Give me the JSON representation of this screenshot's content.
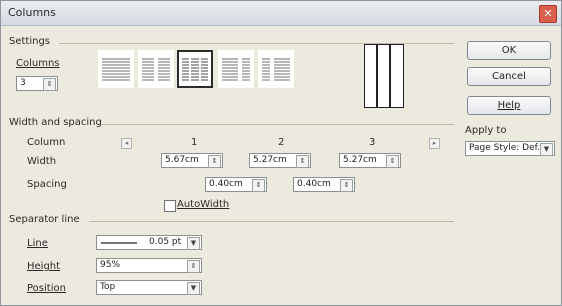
{
  "window": {
    "title": "Columns",
    "close_glyph": "✕"
  },
  "settings": {
    "group_label": "Settings",
    "columns_label": "Columns",
    "columns_value": "3",
    "presets": [
      {
        "name": "one-column-layout",
        "selected": false
      },
      {
        "name": "two-column-layout",
        "selected": false
      },
      {
        "name": "three-column-layout",
        "selected": true
      },
      {
        "name": "two-column-left-wide-layout",
        "selected": false
      },
      {
        "name": "two-column-right-wide-layout",
        "selected": false
      }
    ],
    "preview_columns": 3
  },
  "buttons": {
    "ok": "OK",
    "cancel": "Cancel",
    "help": "Help"
  },
  "apply_to": {
    "label": "Apply to",
    "value": "Page Style: Def..."
  },
  "width_spacing": {
    "group_label": "Width and spacing",
    "column_label": "Column",
    "width_label": "Width",
    "spacing_label": "Spacing",
    "columns": [
      "1",
      "2",
      "3"
    ],
    "widths": [
      "5.67cm",
      "5.27cm",
      "5.27cm"
    ],
    "spacings": [
      "0.40cm",
      "0.40cm"
    ],
    "autowidth_label": "AutoWidth",
    "autowidth_checked": false
  },
  "separator": {
    "group_label": "Separator line",
    "line_label": "Line",
    "line_value": "0.05 pt",
    "height_label": "Height",
    "height_value": "95%",
    "position_label": "Position",
    "position_value": "Top"
  }
}
